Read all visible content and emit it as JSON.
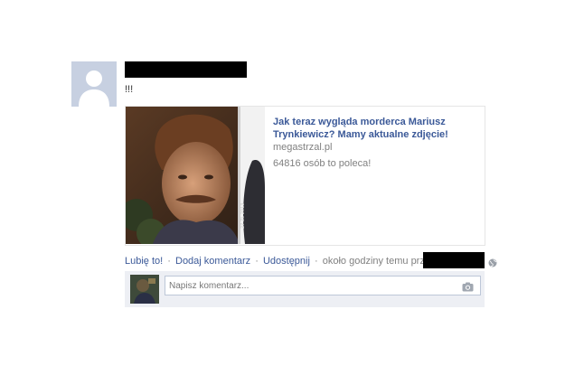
{
  "post": {
    "status_text": "!!!",
    "share": {
      "title": "Jak teraz wygląda morderca Mariusz Trynkiewicz? Mamy aktualne zdjęcie!",
      "domain": "megastrzal.pl",
      "likes_text": "64816 osób to poleca!"
    },
    "actions": {
      "like": "Lubię to!",
      "comment": "Dodaj komentarz",
      "share": "Udostępnij",
      "time_text": "około godziny temu przez:",
      "separator": "·"
    },
    "comment_box": {
      "placeholder": "Napisz komentarz..."
    }
  },
  "icons": {
    "avatar": "default-user-silhouette",
    "globe": "globe-icon",
    "camera": "camera-icon"
  },
  "colors": {
    "link": "#3b5998",
    "meta": "#808080",
    "comment_bg": "#edeff4"
  }
}
